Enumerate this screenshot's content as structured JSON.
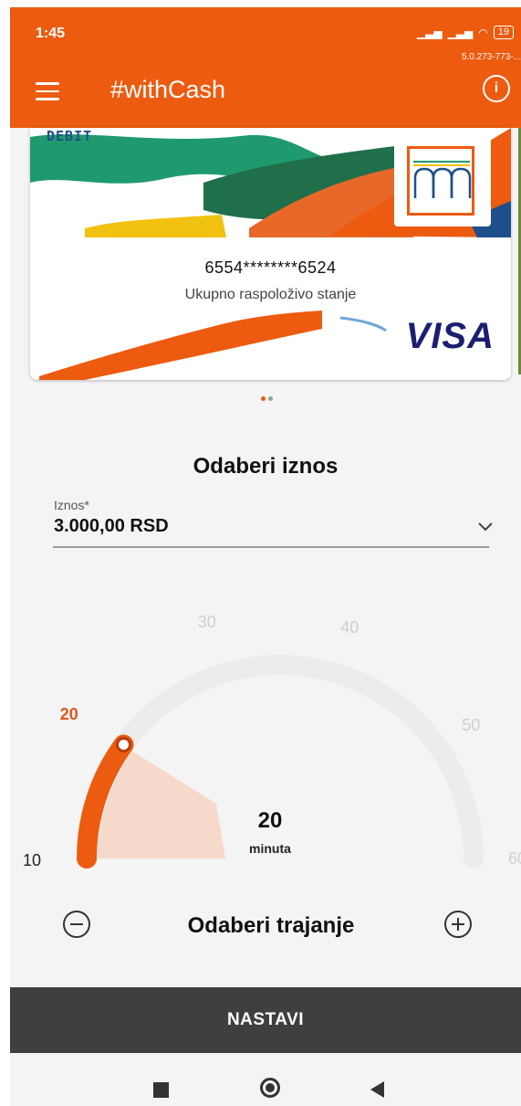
{
  "status_bar": {
    "time": "1:45",
    "battery": "19",
    "version": "5.0.273-773-..."
  },
  "app_bar": {
    "title": "#withCash"
  },
  "card": {
    "type_label": "DEBIT",
    "number": "6554********6524",
    "subtitle": "Ukupno raspoloživo stanje",
    "brand": "VISA"
  },
  "pager": {
    "count": 2,
    "active_index": 0,
    "active_color": "#ec5b0f",
    "inactive_color": "#9e9e9e"
  },
  "amount_section": {
    "title": "Odaberi iznos",
    "field_label": "Iznos*",
    "field_value": "3.000,00 RSD"
  },
  "duration": {
    "ticks": [
      "10",
      "20",
      "30",
      "40",
      "50",
      "60"
    ],
    "min": 10,
    "max": 60,
    "selected": 20,
    "selected_value": "20",
    "unit": "minuta",
    "label": "Odaberi trajanje"
  },
  "colors": {
    "accent": "#ec5b0f",
    "button_bg": "#3f3f3f",
    "track": "#ececec"
  },
  "actions": {
    "continue": "NASTAVI"
  }
}
